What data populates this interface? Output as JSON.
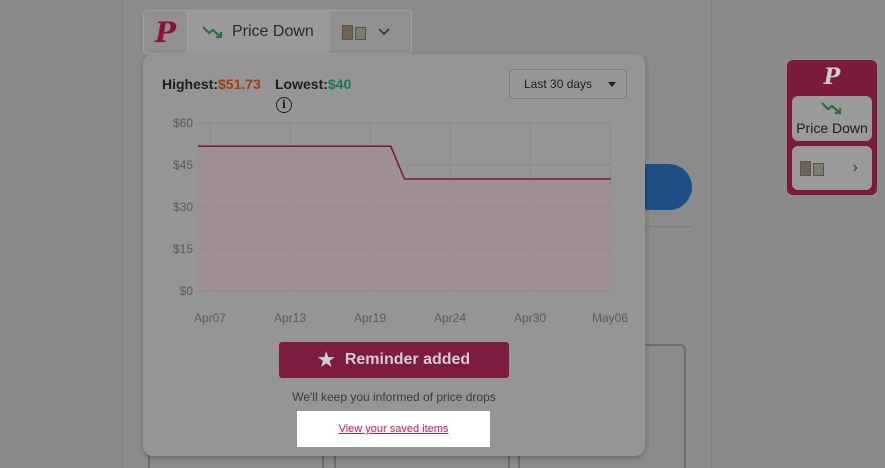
{
  "extension_bar": {
    "logo_text": "P",
    "price_status": "Price Down",
    "icons": [
      "price-down-arrow-icon",
      "product-thumbnail-icon",
      "chevron-down-icon"
    ]
  },
  "side_widget": {
    "logo_text": "P",
    "price_status": "Price Down",
    "icons": [
      "price-down-arrow-icon",
      "product-thumbnail-icon",
      "chevron-right-icon"
    ]
  },
  "popup": {
    "highest_label": "Highest:",
    "highest_value": "$51.73",
    "lowest_label": "Lowest:",
    "lowest_value": "$40",
    "period_selected": "Last 30 days",
    "reminder_button": "Reminder added",
    "keep_informed": "We'll keep you informed of price drops",
    "saved_link": "View your saved items"
  },
  "colors": {
    "brand": "#d4145a",
    "highest": "#e06020",
    "lowest": "#20b08a",
    "price_down_green": "#2e9e4a"
  },
  "chart_data": {
    "type": "line",
    "x_tick_labels": [
      "Apr07",
      "Apr13",
      "Apr19",
      "Apr24",
      "Apr30",
      "May06"
    ],
    "y_tick_labels": [
      "$60",
      "$45",
      "$30",
      "$15",
      "$0"
    ],
    "y_ticks": [
      60,
      45,
      30,
      15,
      0
    ],
    "ylim": [
      0,
      60
    ],
    "x_start": "2024-04-06",
    "x_end": "2024-05-06",
    "series": [
      {
        "points": [
          {
            "x": "2024-04-06",
            "y": 51.73
          },
          {
            "x": "2024-04-20",
            "y": 51.73
          },
          {
            "x": "2024-04-21",
            "y": 40
          },
          {
            "x": "2024-05-06",
            "y": 40
          }
        ]
      }
    ],
    "grid": true,
    "area_fill": true
  }
}
